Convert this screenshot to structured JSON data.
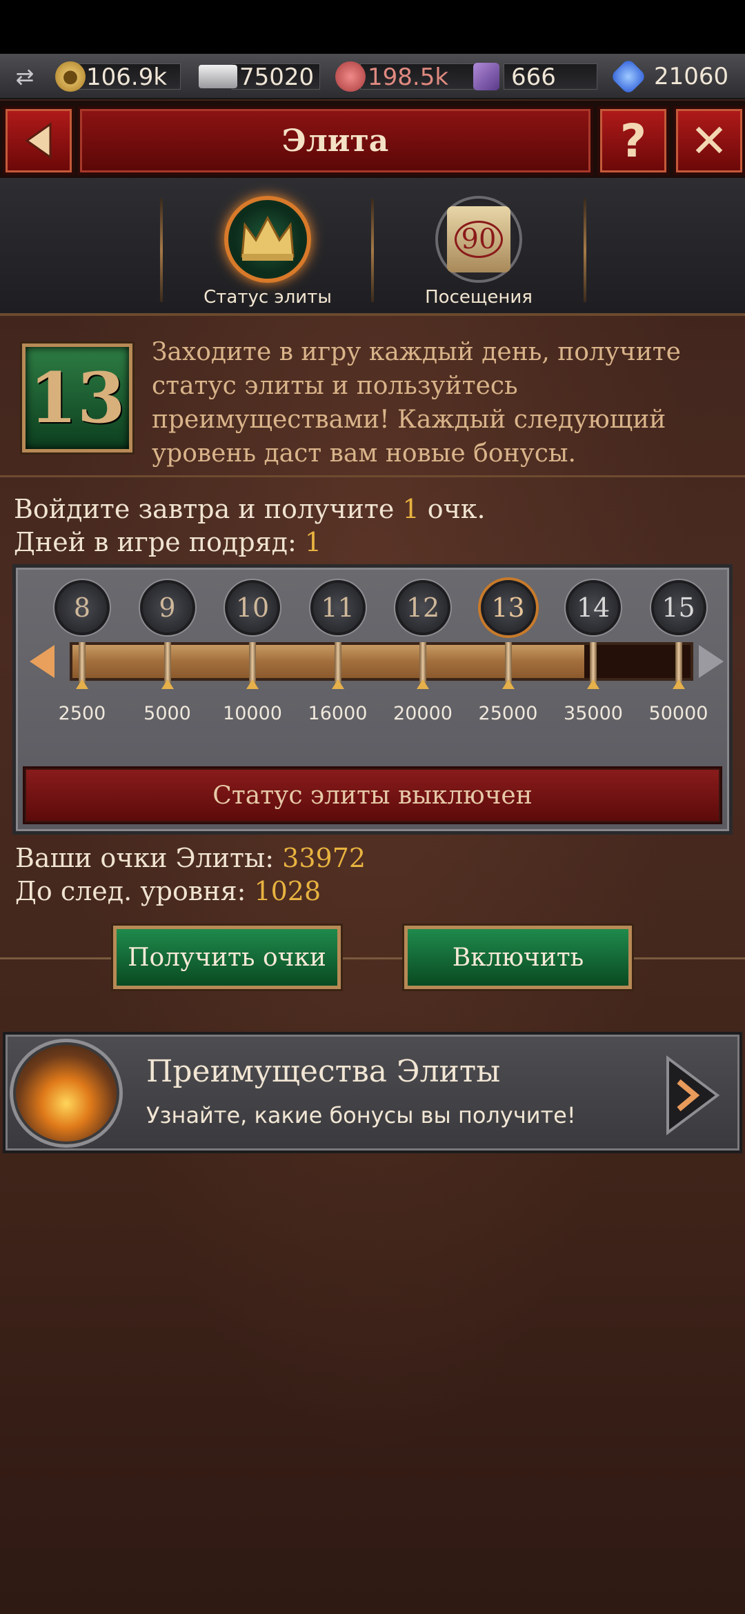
{
  "resources": {
    "swap_icon": "swap-arrows-icon",
    "gold": "106.9k",
    "silver": "75020",
    "food": "198.5k",
    "stone": "666",
    "gems": "21060"
  },
  "header": {
    "title": "Элита",
    "back_icon": "back-arrow-icon",
    "help_label": "?",
    "close_label": "✕"
  },
  "tabs": [
    {
      "label": "Статус элиты",
      "icon": "crown-icon"
    },
    {
      "label": "Посещения",
      "icon": "calendar-icon",
      "badge": "90"
    }
  ],
  "info": {
    "level": "13",
    "text": "Заходите в игру каждый день, получите статус элиты и пользуйтесь преимуществами! Каждый следующий уровень даст вам новые бонусы."
  },
  "daily": {
    "login_prefix": "Войдите завтра и получите ",
    "login_points": "1",
    "login_suffix": " очк.",
    "days_label": "Дней в игре подряд: ",
    "days_value": "1"
  },
  "progress": {
    "levels": [
      "8",
      "9",
      "10",
      "11",
      "12",
      "13",
      "14",
      "15"
    ],
    "thresholds": [
      "2500",
      "5000",
      "10000",
      "16000",
      "20000",
      "25000",
      "35000",
      "50000"
    ],
    "current_level": "13",
    "current_points": 33972,
    "status_label": "Статус элиты выключен"
  },
  "points": {
    "elite_label": "Ваши очки Элиты: ",
    "elite_value": "33972",
    "next_label": "До след. уровня: ",
    "next_value": "1028"
  },
  "actions": {
    "get_points": "Получить очки",
    "enable": "Включить"
  },
  "advantages": {
    "title": "Преимущества Элиты",
    "subtitle": "Узнайте, какие бонусы вы получите!"
  },
  "colors": {
    "accent_gold": "#e8b340",
    "header_red": "#8d1313",
    "button_green": "#1f8a4c"
  }
}
